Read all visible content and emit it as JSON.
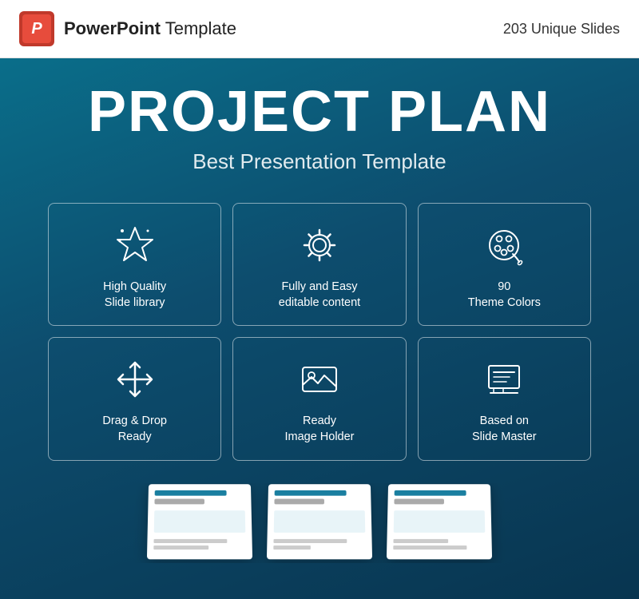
{
  "header": {
    "title_bold": "PowerPoint",
    "title_rest": " Template",
    "unique_slides": "203 Unique Slides",
    "logo_letter": "P"
  },
  "main": {
    "project_title": "PROJECT PLAN",
    "project_subtitle": "Best Presentation Template"
  },
  "features": [
    {
      "id": "high-quality",
      "label": "High Quality\nSlide library",
      "icon": "star"
    },
    {
      "id": "editable",
      "label": "Fully and Easy\neditable content",
      "icon": "gear"
    },
    {
      "id": "theme-colors",
      "label": "90\nTheme Colors",
      "icon": "palette"
    },
    {
      "id": "drag-drop",
      "label": "Drag & Drop\nReady",
      "icon": "move"
    },
    {
      "id": "image-holder",
      "label": "Ready\nImage Holder",
      "icon": "image"
    },
    {
      "id": "slide-master",
      "label": "Based on\nSlide Master",
      "icon": "slides"
    }
  ]
}
